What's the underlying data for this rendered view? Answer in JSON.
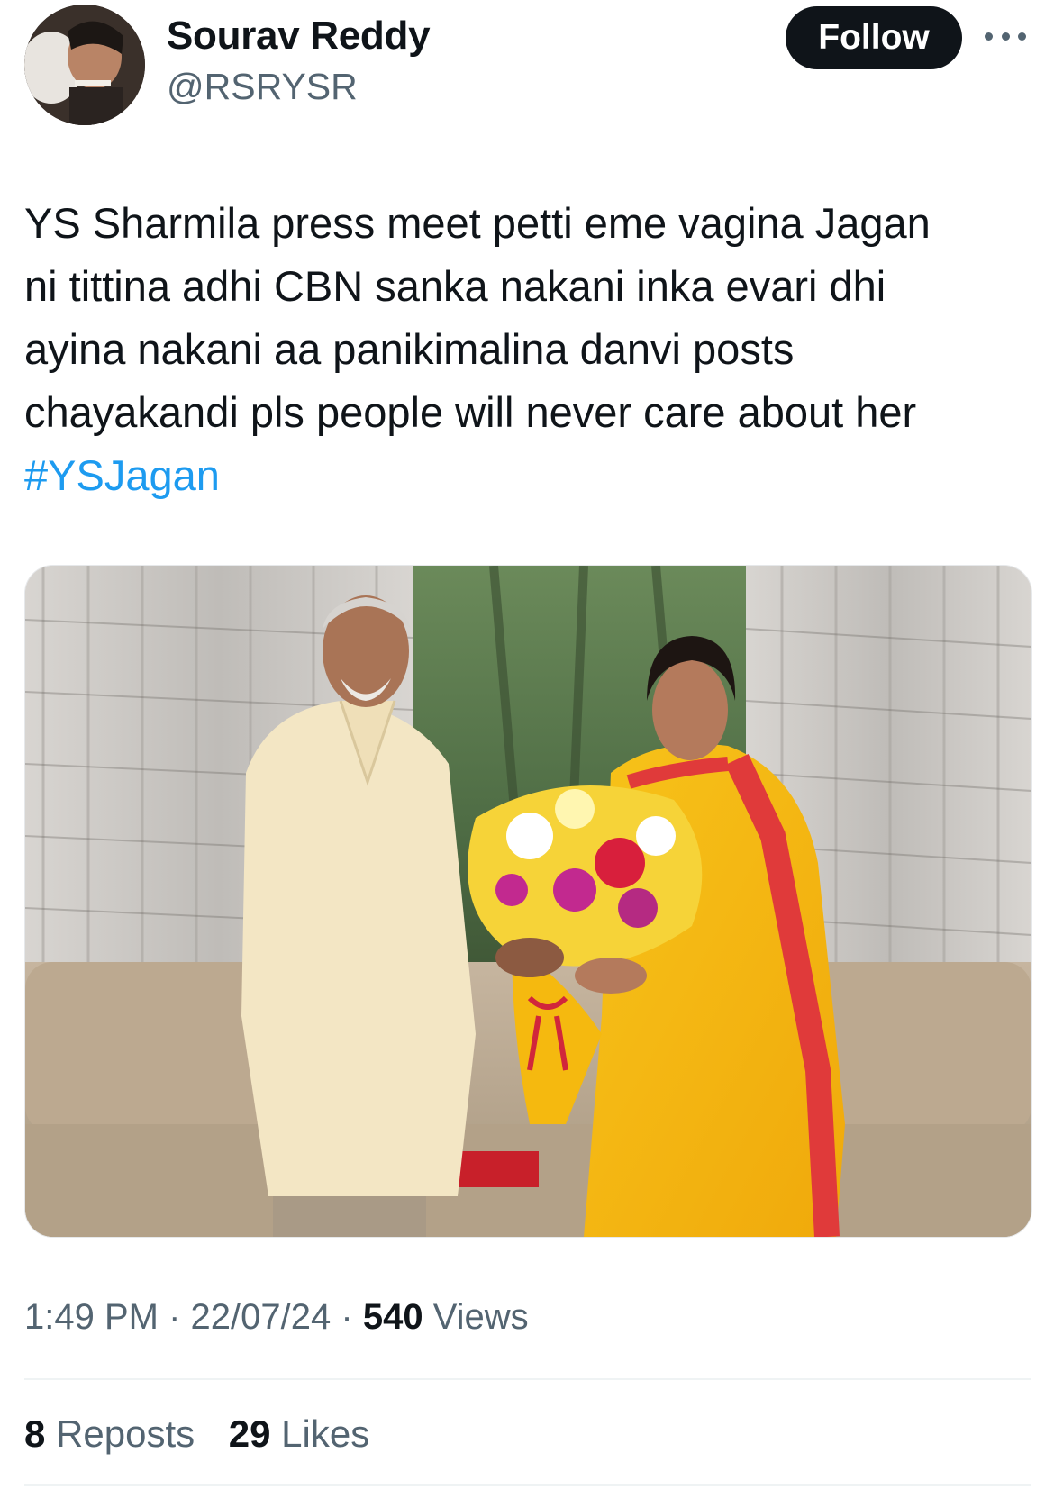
{
  "user": {
    "display_name": "Sourav Reddy",
    "handle": "@RSRYSR"
  },
  "follow_label": "Follow",
  "tweet": {
    "lines": [
      "YS Sharmila press meet petti eme vagina Jagan",
      "ni tittina adhi CBN sanka nakani inka evari dhi",
      "ayina nakani aa panikimalina danvi posts",
      "chayakandi pls people will never care about her"
    ],
    "hashtag": "#YSJagan"
  },
  "meta": {
    "time": "1:49 PM",
    "date": "22/07/24",
    "views_count": "540",
    "views_label": "Views",
    "separator": "·"
  },
  "stats": {
    "reposts_count": "8",
    "reposts_label": "Reposts",
    "likes_count": "29",
    "likes_label": "Likes"
  },
  "colors": {
    "text": "#0f1419",
    "secondary": "#536471",
    "link": "#1d9bf0",
    "button_bg": "#0f1419"
  }
}
